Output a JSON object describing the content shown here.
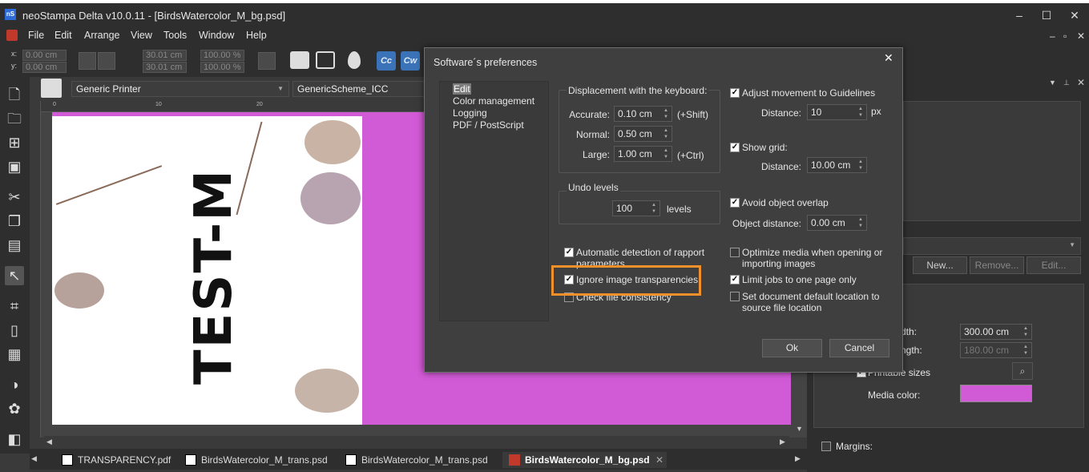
{
  "window": {
    "title": "neoStampa Delta  v10.0.11 - [BirdsWatercolor_M_bg.psd]",
    "app_icon": "nS",
    "controls": [
      "–",
      "☐",
      "✕"
    ]
  },
  "menu": {
    "items": [
      "File",
      "Edit",
      "Arrange",
      "View",
      "Tools",
      "Window",
      "Help"
    ],
    "right_controls": [
      "–",
      "▫",
      "✕"
    ]
  },
  "toolbar": {
    "x_label": "x:",
    "y_label": "y:",
    "x_value": "0.00 cm",
    "y_value": "0.00 cm",
    "w_value": "30.01 cm",
    "h_value": "30.01 cm",
    "scale_x": "100.00 %",
    "scale_y": "100.00 %",
    "cc_label": "Cc",
    "cw_label": "Cw"
  },
  "printer_bar": {
    "printer": "Generic Printer",
    "scheme": "GenericScheme_ICC"
  },
  "ruler": {
    "unit": "cm",
    "ticks": [
      "0",
      "10",
      "20"
    ]
  },
  "canvas": {
    "text": "TEST-M",
    "page_color": "#d15ad6"
  },
  "tabs": [
    {
      "label": "TRANSPARENCY.pdf",
      "active": false
    },
    {
      "label": "BirdsWatercolor_M_trans.psd",
      "active": false
    },
    {
      "label": "BirdsWatercolor_M_trans.psd",
      "active": false
    },
    {
      "label": "BirdsWatercolor_M_bg.psd",
      "active": true
    }
  ],
  "tab_close": "✕",
  "right_panel": {
    "new_label": "New...",
    "remove_label": "Remove...",
    "edit_label": "Edit...",
    "width_label": "dth:",
    "width_value": "300.00 cm",
    "length_label": "ngth:",
    "length_value": "180.00 cm",
    "printable_label": "Printable sizes",
    "media_color_label": "Media color:",
    "media_color": "#d15ad6",
    "margins_label": "Margins:"
  },
  "dialog": {
    "title": "Software´s preferences",
    "close": "✕",
    "nav": [
      "Edit",
      "Color management",
      "Logging",
      "PDF / PostScript"
    ],
    "keyboard_group": "Displacement with the keyboard:",
    "accurate_label": "Accurate:",
    "accurate_value": "0.10 cm",
    "accurate_suffix": "(+Shift)",
    "normal_label": "Normal:",
    "normal_value": "0.50 cm",
    "large_label": "Large:",
    "large_value": "1.00 cm",
    "large_suffix": "(+Ctrl)",
    "undo_group": "Undo levels",
    "undo_value": "100",
    "undo_suffix": "levels",
    "adjust_guidelines": "Adjust movement to Guidelines",
    "guide_distance_label": "Distance:",
    "guide_distance_value": "10",
    "guide_distance_unit": "px",
    "show_grid": "Show grid:",
    "grid_distance_label": "Distance:",
    "grid_distance_value": "10.00 cm",
    "avoid_overlap": "Avoid object overlap",
    "object_distance_label": "Object distance:",
    "object_distance_value": "0.00 cm",
    "auto_rapport_1": "Automatic detection of rapport",
    "auto_rapport_2": "parameters",
    "ignore_transparencies": "Ignore image transparencies",
    "check_consistency": "Check file consistency",
    "optimize_media_1": "Optimize media when opening or",
    "optimize_media_2": "importing images",
    "limit_jobs": "Limit jobs to one page only",
    "default_location_1": "Set document default location to",
    "default_location_2": "source file location",
    "ok_label": "Ok",
    "cancel_label": "Cancel"
  },
  "highlight_color": "#f0902a"
}
